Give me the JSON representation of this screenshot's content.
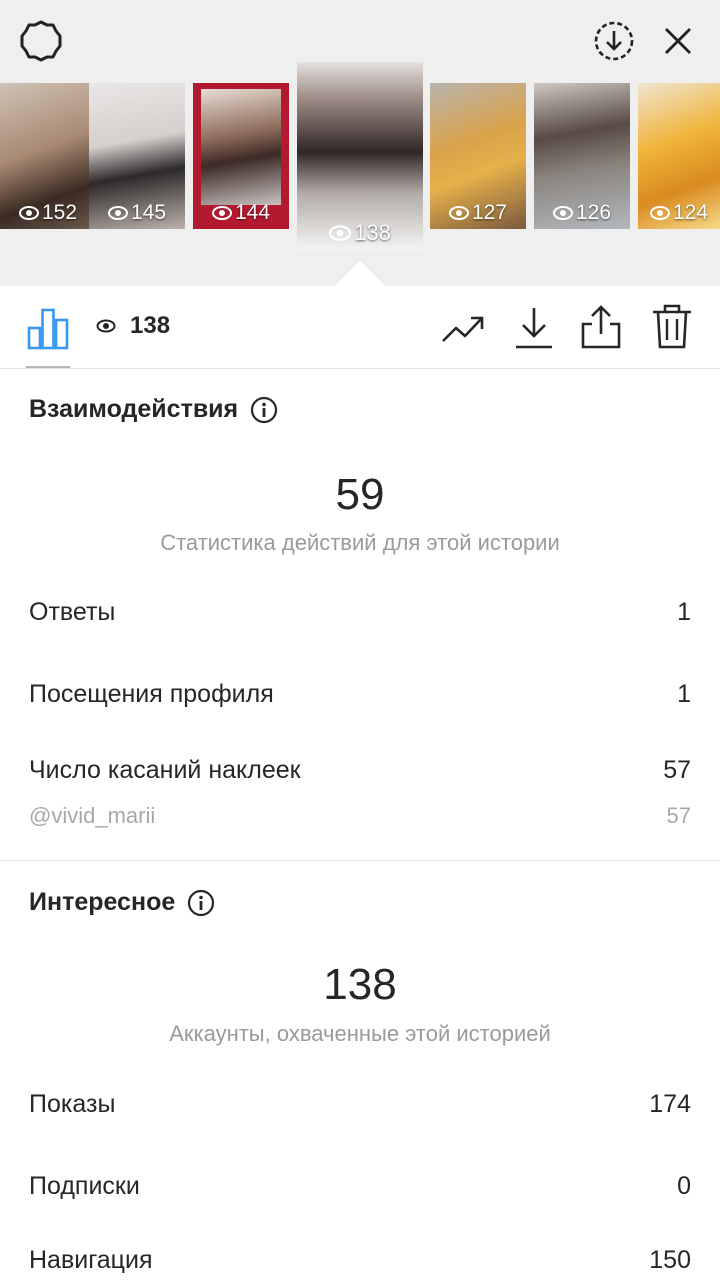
{
  "header": {
    "settings_icon": "gear-icon",
    "download_story_icon": "download-circle-icon",
    "close_icon": "close-icon"
  },
  "stories": [
    {
      "views": "152"
    },
    {
      "views": "145"
    },
    {
      "views": "144"
    },
    {
      "views": "138",
      "selected": true
    },
    {
      "views": "127"
    },
    {
      "views": "126"
    },
    {
      "views": "124"
    }
  ],
  "toolbar": {
    "views": "138",
    "icons": [
      "bar-chart-icon",
      "eye-icon",
      "trend-icon",
      "download-icon",
      "share-icon",
      "trash-icon"
    ],
    "accent": "#3897f0"
  },
  "interactions": {
    "title": "Взаимодействия",
    "total": "59",
    "caption": "Статистика действий для этой истории",
    "rows": [
      {
        "label": "Ответы",
        "value": "1"
      },
      {
        "label": "Посещения профиля",
        "value": "1"
      },
      {
        "label": "Число касаний наклеек",
        "value": "57"
      },
      {
        "label": "@vivid_marii",
        "value": "57"
      }
    ]
  },
  "discovery": {
    "title": "Интересное",
    "total": "138",
    "caption": "Аккаунты, охваченные этой историей",
    "rows": [
      {
        "label": "Показы",
        "value": "174"
      },
      {
        "label": "Подписки",
        "value": "0"
      },
      {
        "label": "Навигация",
        "value": "150"
      }
    ]
  }
}
